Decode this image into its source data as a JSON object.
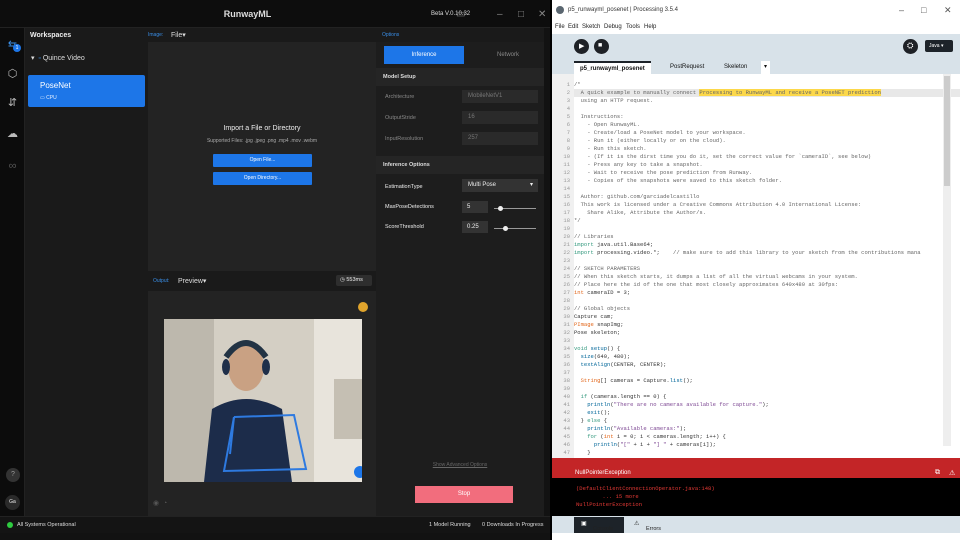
{
  "runway": {
    "title": "RunwayML",
    "version": "Beta V.0.10.32",
    "workspaces_label": "Workspaces",
    "workspace_name": "Quince Video",
    "model": {
      "name": "PoseNet",
      "device": "CPU"
    },
    "rail_badge": "1",
    "user_initials": "Ga",
    "help_label": "?",
    "input": {
      "label": "Image:",
      "source": "File",
      "import_title": "Import a File or Directory",
      "supported": "Supported Files: .jpg .jpeg .png .mp4 .mov .webm",
      "open_file": "Open File...",
      "open_dir": "Open Directory..."
    },
    "output": {
      "label": "Output:",
      "view": "Preview",
      "latency": "553ms"
    },
    "options": {
      "label": "Options",
      "tab_inference": "Inference",
      "tab_network": "Network",
      "model_setup": "Model Setup",
      "architecture_label": "Architecture",
      "architecture_value": "MobileNetV1",
      "output_stride_label": "OutputStride",
      "output_stride_value": "16",
      "input_resolution_label": "InputResolution",
      "input_resolution_value": "257",
      "inference_options": "Inference Options",
      "estimation_label": "EstimationType",
      "estimation_value": "Multi Pose",
      "max_det_label": "MaxPoseDetections",
      "max_det_value": "5",
      "score_label": "ScoreThreshold",
      "score_value": "0.25",
      "max_det_level": 0.1,
      "score_level": 0.25,
      "advanced": "Show Advanced Options",
      "stop": "Stop"
    },
    "status": {
      "system": "All Systems Operational",
      "running": "1 Model Running",
      "downloads": "0 Downloads In Progress"
    }
  },
  "processing": {
    "title": "p5_runwayml_posenet | Processing 3.5.4",
    "menu": [
      "File",
      "Edit",
      "Sketch",
      "Debug",
      "Tools",
      "Help"
    ],
    "mode": "Java",
    "tabs": [
      "p5_runwayml_posenet",
      "PostRequest",
      "Skeleton"
    ],
    "error": "NullPointerException",
    "console": [
      "(DefaultClientConnectionOperator.java:148)",
      "        ... 15 more",
      "NullPointerException"
    ],
    "console_tab": "Console",
    "errors_tab": "Errors"
  }
}
